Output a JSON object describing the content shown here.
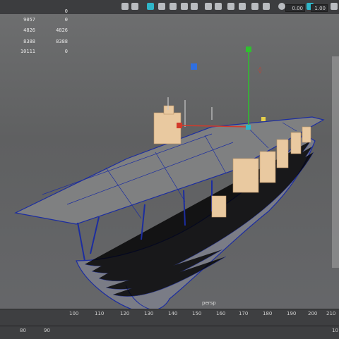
{
  "toolbar": {
    "field1": "0.00",
    "field2": "1.00"
  },
  "stats": {
    "rows": [
      {
        "left": "9057",
        "right": "0"
      },
      {
        "left": "4826",
        "right": "4826"
      },
      {
        "left": "8388",
        "right": "8388"
      },
      {
        "left": "10111",
        "right": "0"
      }
    ],
    "top_right": "0"
  },
  "viewport": {
    "camera_label": "persp"
  },
  "timeline": {
    "ticks": [
      "100",
      "110",
      "120",
      "130",
      "140",
      "150",
      "160",
      "170",
      "180",
      "190",
      "200",
      "210"
    ],
    "bottom": [
      "80",
      "90",
      "10"
    ]
  },
  "colors": {
    "wire_blue": "#1c2da0",
    "selection_tan": "#e9c9a0",
    "axis_green": "#2ec12e",
    "axis_red": "#d23a2a",
    "axis_blue": "#2f6fe0"
  }
}
